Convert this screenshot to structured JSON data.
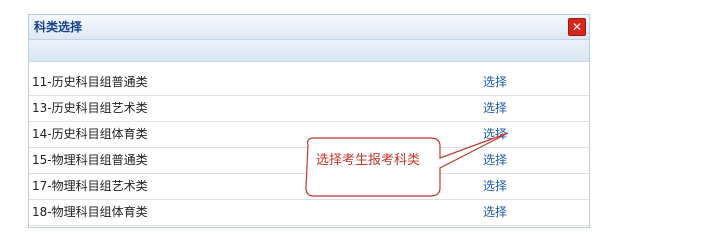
{
  "dialog": {
    "title": "科类选择",
    "close_icon": "close-icon"
  },
  "rows": [
    {
      "name": "11-历史科目组普通类",
      "action": "选择"
    },
    {
      "name": "13-历史科目组艺术类",
      "action": "选择"
    },
    {
      "name": "14-历史科目组体育类",
      "action": "选择"
    },
    {
      "name": "15-物理科目组普通类",
      "action": "选择"
    },
    {
      "name": "17-物理科目组艺术类",
      "action": "选择"
    },
    {
      "name": "18-物理科目组体育类",
      "action": "选择"
    }
  ],
  "annotation": {
    "text": "选择考生报考科类",
    "color": "#c0392b"
  }
}
